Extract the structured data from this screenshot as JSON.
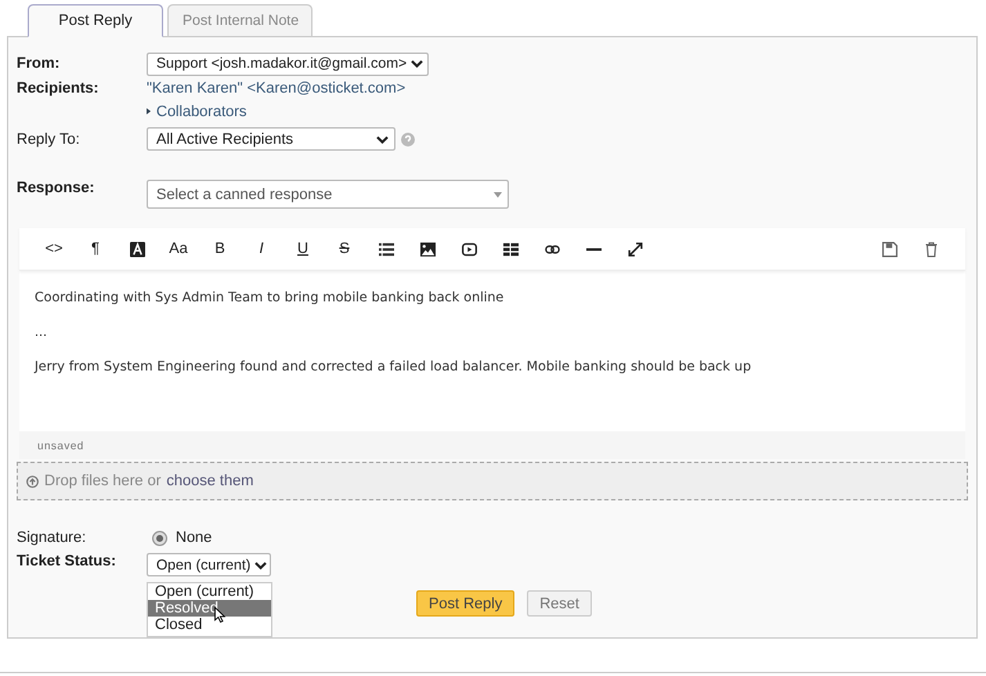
{
  "tabs": [
    {
      "label": "Post Reply",
      "selected": true
    },
    {
      "label": "Post Internal Note",
      "selected": false
    }
  ],
  "from": {
    "label": "From:",
    "value": "Support <josh.madakor.it@gmail.com>"
  },
  "recipients": {
    "label": "Recipients:",
    "value": "\"Karen Karen\" <Karen@osticket.com>",
    "collaborators": "Collaborators"
  },
  "reply_to": {
    "label": "Reply To:",
    "value": "All Active Recipients"
  },
  "response": {
    "label": "Response:",
    "placeholder": "Select a canned response"
  },
  "toolbar": [
    {
      "kind": "char",
      "label": "<>"
    },
    {
      "kind": "char",
      "label": "¶"
    },
    {
      "kind": "textcolor"
    },
    {
      "kind": "char",
      "label": "Aa"
    },
    {
      "kind": "char",
      "label": "B"
    },
    {
      "kind": "italic",
      "label": "I"
    },
    {
      "kind": "underline",
      "label": "U"
    },
    {
      "kind": "strike",
      "label": "S"
    },
    {
      "kind": "list"
    },
    {
      "kind": "image"
    },
    {
      "kind": "video"
    },
    {
      "kind": "table"
    },
    {
      "kind": "link"
    },
    {
      "kind": "rule"
    },
    {
      "kind": "expand"
    }
  ],
  "editor": {
    "paragraphs": [
      "Coordinating with Sys Admin Team to bring mobile banking back online",
      "...",
      "Jerry from System Engineering found and corrected a failed load balancer. Mobile banking should be back up"
    ],
    "status": "unsaved"
  },
  "dropzone": {
    "text": "Drop files here or",
    "link": "choose them"
  },
  "signature": {
    "label": "Signature:",
    "option": "None",
    "checked": true
  },
  "ticket_status": {
    "label": "Ticket Status:",
    "value": "Open (current)",
    "options": [
      {
        "label": "Open (current)",
        "highlighted": false
      },
      {
        "label": "Resolved",
        "highlighted": true
      },
      {
        "label": "Closed",
        "highlighted": false
      }
    ]
  },
  "buttons": [
    {
      "label": "Post Reply",
      "kind": "primary"
    },
    {
      "label": "Reset",
      "kind": "secondary"
    }
  ]
}
